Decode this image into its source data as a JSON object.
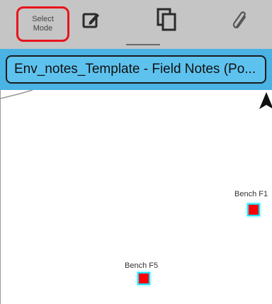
{
  "toolbar": {
    "select_mode_line1": "Select",
    "select_mode_line2": "Mode",
    "icons": [
      "edit-note-icon",
      "copy-icon",
      "paperclip-icon"
    ]
  },
  "title": {
    "text": "Env_notes_Template - Field Notes (Po..."
  },
  "map": {
    "features": [
      {
        "label": "Bench F1",
        "marker_color": "#ff0000"
      },
      {
        "label": "Bench F5",
        "marker_color": "#ff0000"
      }
    ],
    "highlight_color": "#20e0ff"
  },
  "colors": {
    "toolbar_bg": "#c5c5c5",
    "title_bar_bg": "#49b3e3",
    "title_box_bg": "#5ec2ee",
    "selection_outline": "#e8141b"
  }
}
